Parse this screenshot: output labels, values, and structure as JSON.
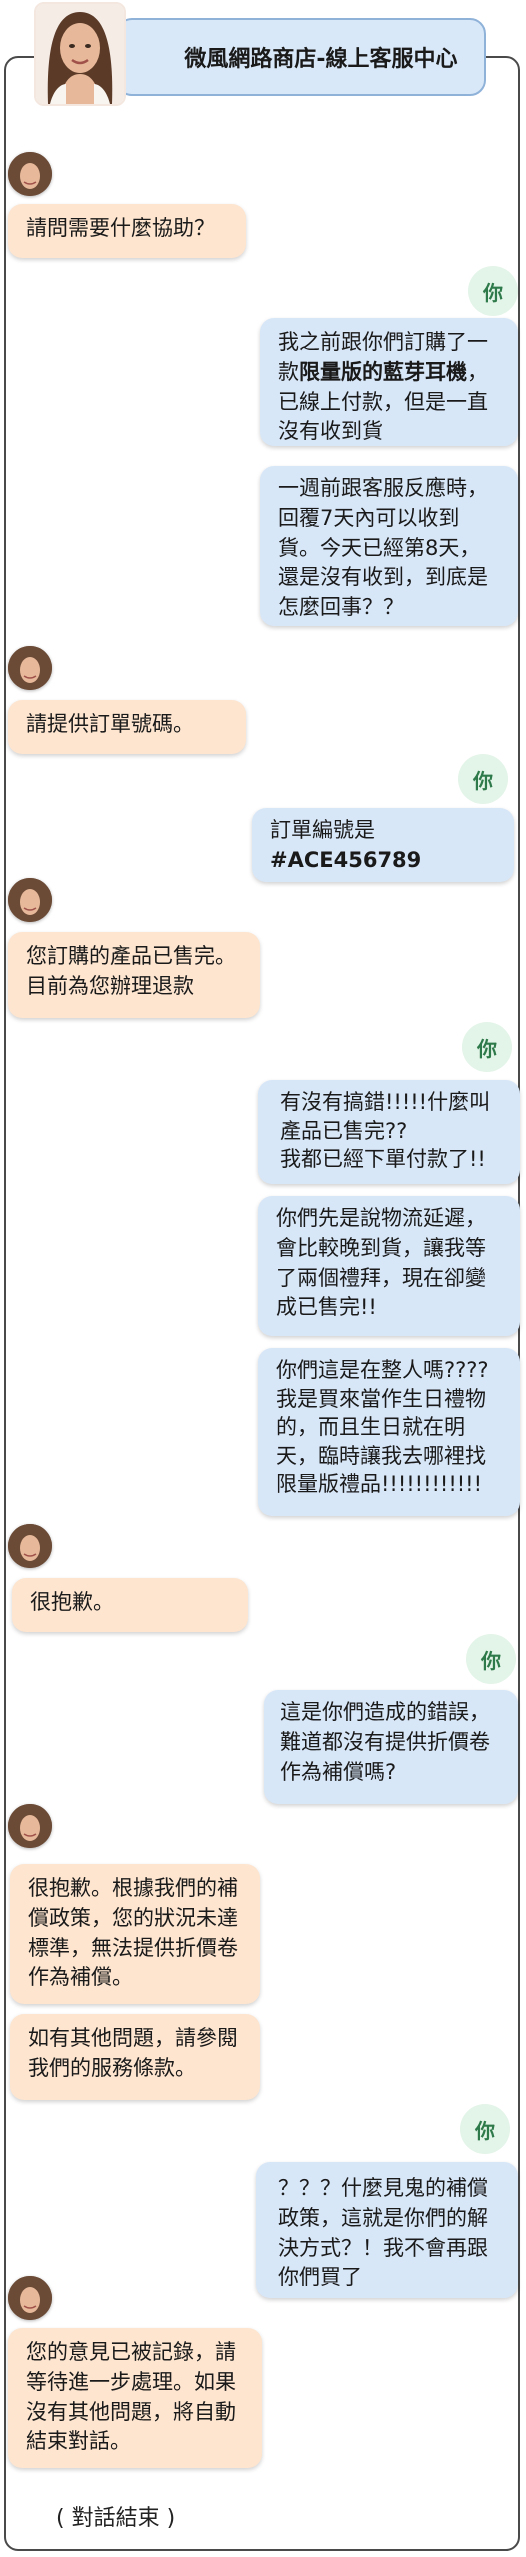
{
  "header": {
    "title": "微風網路商店-線上客服中心"
  },
  "you_label": "你",
  "messages": {
    "m1": "請問需要什麼協助？",
    "m2a": "我之前跟你們訂購了一款",
    "m2b": "限量版的藍芽耳機",
    "m2c": "，已線上付款，但是一直沒有收到貨",
    "m3": "一週前跟客服反應時，回覆7天內可以收到貨。今天已經第8天，還是沒有收到，到底是怎麼回事？？",
    "m4": "請提供訂單號碼。",
    "m5a": "訂單編號是",
    "m5b": "#ACE456789",
    "m6": "您訂購的產品已售完。\n目前為您辦理退款",
    "m7": "有沒有搞錯!!!!!什麼叫\n產品已售完??\n我都已經下單付款了!!",
    "m8": "你們先是說物流延遲，會比較晚到貨，讓我等了兩個禮拜，現在卻變成已售完!!",
    "m9": "你們這是在整人嗎????我是買來當作生日禮物的，而且生日就在明天，臨時讓我去哪裡找限量版禮品!!!!!!!!!!!!",
    "m10": "很抱歉。",
    "m11": "這是你們造成的錯誤，難道都沒有提供折價卷作為補償嗎?",
    "m12": "很抱歉。根據我們的補償政策，您的狀況未達標準，無法提供折價卷作為補償。",
    "m13": "如有其他問題，請參閱我們的服務條款。",
    "m14": "？？？什麼見鬼的補償政策，這就是你們的解決方式？！我不會再跟你們買了",
    "m15": "您的意見已被記錄，請等待進一步處理。如果沒有其他問題，將自動結束對話。"
  },
  "end_note": "( 對話結束 )",
  "colors": {
    "agent_bubble": "#fde5d0",
    "user_bubble": "#d8e7f8",
    "header_bg": "#d9e8f8",
    "you_badge": "#e3f4e8"
  }
}
